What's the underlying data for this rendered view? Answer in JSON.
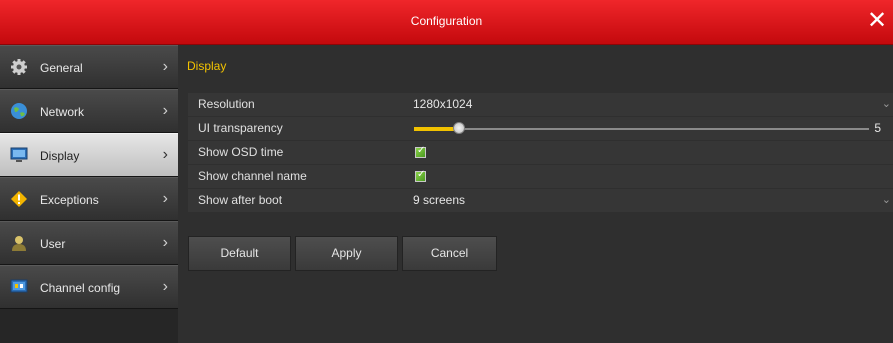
{
  "window": {
    "title": "Configuration",
    "close_glyph": "✕"
  },
  "sidebar": {
    "items": [
      {
        "label": "General",
        "icon": "gear-icon",
        "active": false
      },
      {
        "label": "Network",
        "icon": "globe-icon",
        "active": false
      },
      {
        "label": "Display",
        "icon": "monitor-icon",
        "active": true
      },
      {
        "label": "Exceptions",
        "icon": "warning-icon",
        "active": false
      },
      {
        "label": "User",
        "icon": "user-icon",
        "active": false
      },
      {
        "label": "Channel config",
        "icon": "channel-config-icon",
        "active": false
      }
    ],
    "chevron": "›"
  },
  "main": {
    "section_title": "Display",
    "rows": {
      "resolution": {
        "label": "Resolution",
        "value": "1280x1024"
      },
      "ui_transparency": {
        "label": "UI transparency",
        "value": "5",
        "level_fraction": 0.05
      },
      "show_osd_time": {
        "label": "Show OSD time",
        "checked": true
      },
      "show_channel_name": {
        "label": "Show channel name",
        "checked": true
      },
      "show_after_boot": {
        "label": "Show after boot",
        "value": "9 screens"
      }
    },
    "buttons": {
      "default": "Default",
      "apply": "Apply",
      "cancel": "Cancel"
    }
  },
  "colors": {
    "titlebar": "#d9161b",
    "accent_yellow": "#f2c200",
    "checkbox_green": "#6cbc36"
  }
}
